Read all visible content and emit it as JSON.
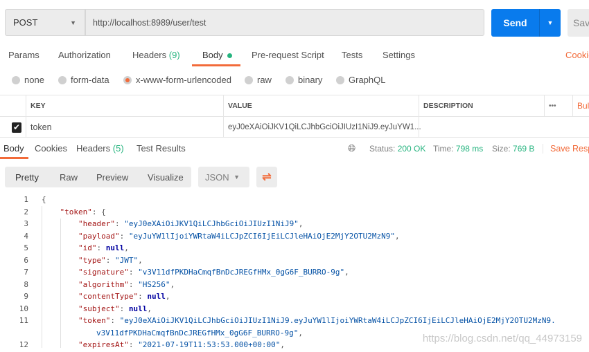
{
  "request": {
    "method": "POST",
    "url": "http://localhost:8989/user/test",
    "send": "Send",
    "save": "Save"
  },
  "tabs": [
    {
      "label": "Params"
    },
    {
      "label": "Authorization"
    },
    {
      "label": "Headers",
      "count": "(9)"
    },
    {
      "label": "Body",
      "active": true
    },
    {
      "label": "Pre-request Script"
    },
    {
      "label": "Tests"
    },
    {
      "label": "Settings"
    }
  ],
  "cookies_link": "Cookies",
  "body_types": [
    {
      "label": "none"
    },
    {
      "label": "form-data"
    },
    {
      "label": "x-www-form-urlencoded",
      "selected": true
    },
    {
      "label": "raw"
    },
    {
      "label": "binary"
    },
    {
      "label": "GraphQL"
    }
  ],
  "params_table": {
    "headers": [
      "KEY",
      "VALUE",
      "DESCRIPTION"
    ],
    "more": "•••",
    "bulk": "Bulk Edit",
    "rows": [
      {
        "checked": true,
        "key": "token",
        "value": "eyJ0eXAiOiJKV1QiLCJhbGciOiJIUzI1NiJ9.eyJuYW1..."
      }
    ]
  },
  "response": {
    "tabs": [
      {
        "label": "Body",
        "active": true
      },
      {
        "label": "Cookies"
      },
      {
        "label": "Headers",
        "count": "(5)"
      },
      {
        "label": "Test Results"
      }
    ],
    "status_label": "Status:",
    "status": "200 OK",
    "time_label": "Time:",
    "time": "798 ms",
    "size_label": "Size:",
    "size": "769 B",
    "save": "Save Response"
  },
  "view": {
    "modes": [
      "Pretty",
      "Raw",
      "Preview",
      "Visualize"
    ],
    "format": "JSON"
  },
  "code_lines": [
    {
      "n": "1",
      "i": 0,
      "t": "{"
    },
    {
      "n": "2",
      "i": 1,
      "k": "\"token\"",
      "t": ": {"
    },
    {
      "n": "3",
      "i": 2,
      "k": "\"header\"",
      "s": "\"eyJ0eXAiOiJKV1QiLCJhbGciOiJIUzI1NiJ9\"",
      "t": ","
    },
    {
      "n": "4",
      "i": 2,
      "k": "\"payload\"",
      "s": "\"eyJuYW1lIjoiYWRtaW4iLCJpZCI6IjEiLCJleHAiOjE2MjY2OTU2MzN9\"",
      "t": ","
    },
    {
      "n": "5",
      "i": 2,
      "k": "\"id\"",
      "v": "null",
      "t": ","
    },
    {
      "n": "6",
      "i": 2,
      "k": "\"type\"",
      "s": "\"JWT\"",
      "t": ","
    },
    {
      "n": "7",
      "i": 2,
      "k": "\"signature\"",
      "s": "\"v3V11dfPKDHaCmqfBnDcJREGfHMx_0gG6F_BURRO-9g\"",
      "t": ","
    },
    {
      "n": "8",
      "i": 2,
      "k": "\"algorithm\"",
      "s": "\"HS256\"",
      "t": ","
    },
    {
      "n": "9",
      "i": 2,
      "k": "\"contentType\"",
      "v": "null",
      "t": ","
    },
    {
      "n": "10",
      "i": 2,
      "k": "\"subject\"",
      "v": "null",
      "t": ","
    },
    {
      "n": "11",
      "i": 2,
      "k": "\"token\"",
      "s": "\"eyJ0eXAiOiJKV1QiLCJhbGciOiJIUzI1NiJ9.eyJuYW1lIjoiYWRtaW4iLCJpZCI6IjEiLCJleHAiOjE2MjY2OTU2MzN9.",
      "cont": "v3V11dfPKDHaCmqfBnDcJREGfHMx_0gG6F_BURRO-9g\"",
      "t": ","
    },
    {
      "n": "12",
      "i": 2,
      "k": "\"expiresAt\"",
      "s": "\"2021-07-19T11:53:53.000+00:00\"",
      "t": ","
    }
  ],
  "watermark": "https://blog.csdn.net/qq_44973159",
  "colors": {
    "accent": "#f26b3a",
    "send": "#097bed",
    "success": "#26b47f"
  }
}
